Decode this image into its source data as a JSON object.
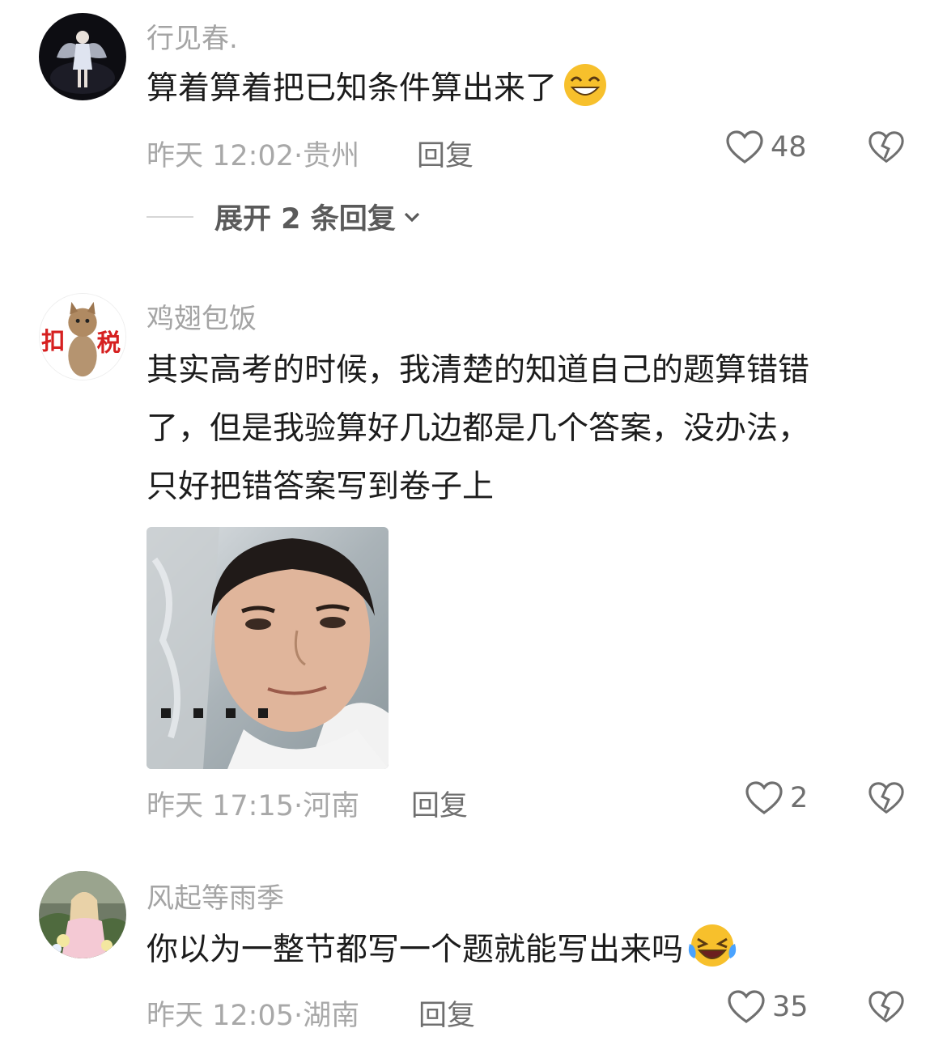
{
  "comments": [
    {
      "username": "行见春.",
      "text": "算着算着把已知条件算出来了",
      "emoji": "smile-emoji",
      "time": "昨天 12:02",
      "location": "贵州",
      "reply_label": "回复",
      "likes": "48",
      "expand_label": "展开 2 条回复"
    },
    {
      "username": "鸡翅包饭",
      "text_lines": [
        "其实高考的时候，我清楚的知道自己的题算错错",
        "了，但是我验算好几边都是几个答案，没办法，",
        "只好把错答案写到卷子上"
      ],
      "image": "meme-photo",
      "time": "昨天 17:15",
      "location": "河南",
      "reply_label": "回复",
      "likes": "2"
    },
    {
      "username": "风起等雨季",
      "text": "你以为一整节都写一个题就能写出来吗",
      "emoji": "laughing-emoji",
      "time": "昨天 12:05",
      "location": "湖南",
      "reply_label": "回复",
      "likes": "35"
    }
  ],
  "separator": "·",
  "colors": {
    "username": "#a4a4a4",
    "text": "#1c1c1c",
    "meta": "#a8a8a8",
    "action": "#6f6f6f"
  }
}
